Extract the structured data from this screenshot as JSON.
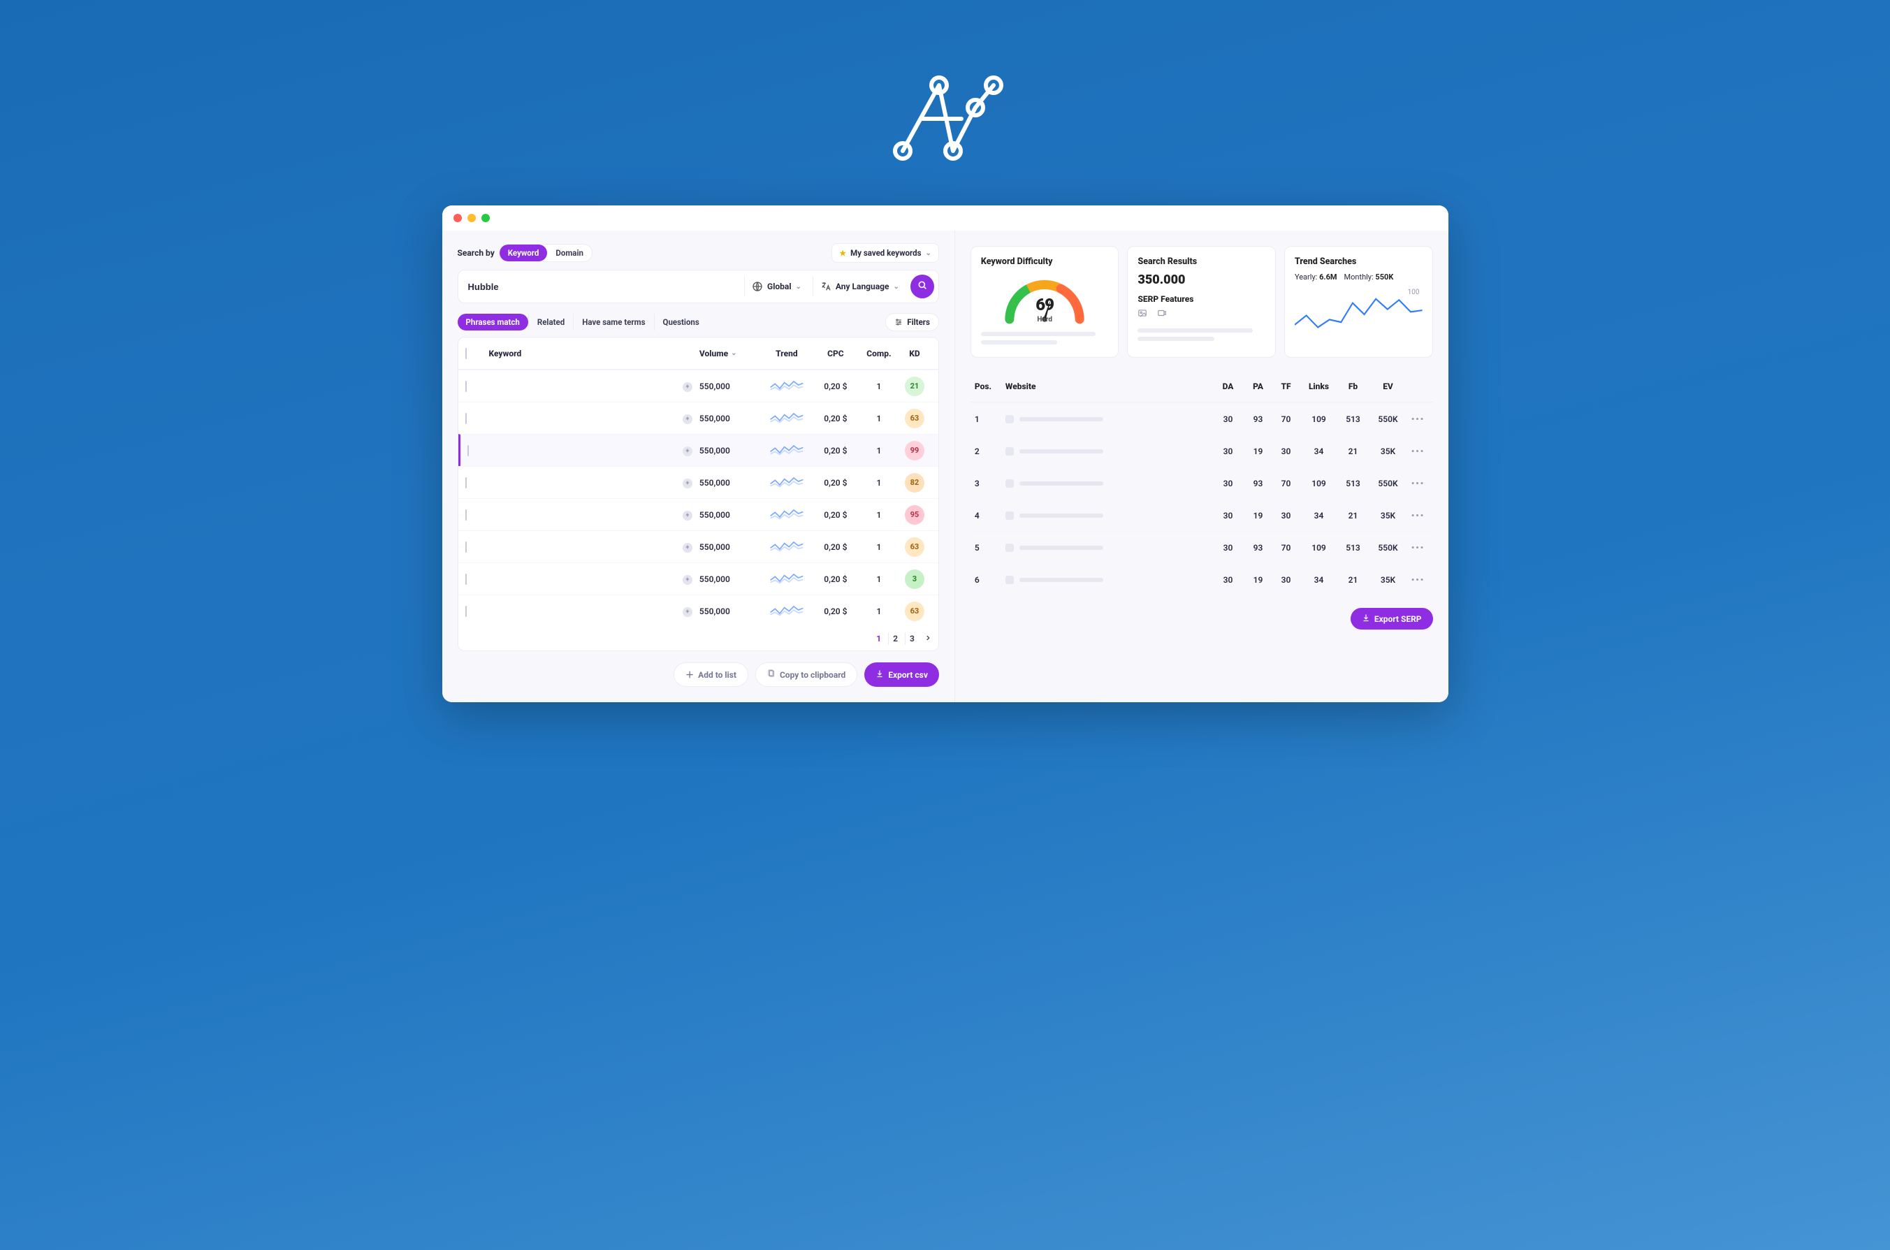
{
  "colors": {
    "accent": "#8e2de2",
    "bg_gradient_start": "#1a6bb5",
    "bg_gradient_end": "#4594d4"
  },
  "topbar": {
    "search_by_label": "Search by",
    "toggle": {
      "keyword": "Keyword",
      "domain": "Domain",
      "active": "Keyword"
    },
    "saved_keywords_label": "My saved keywords"
  },
  "searchbar": {
    "value": "Hubble",
    "region_label": "Global",
    "language_label": "Any Language"
  },
  "tabs": {
    "items": [
      "Phrases match",
      "Related",
      "Have same terms",
      "Questions"
    ],
    "active": "Phrases match",
    "filters_label": "Filters"
  },
  "kw_table": {
    "headers": {
      "keyword": "Keyword",
      "volume": "Volume",
      "trend": "Trend",
      "cpc": "CPC",
      "comp": "Comp.",
      "kd": "KD"
    },
    "rows": [
      {
        "volume": "550,000",
        "cpc": "0,20 $",
        "comp": "1",
        "kd": 21,
        "kd_class": "kd-easy"
      },
      {
        "volume": "550,000",
        "cpc": "0,20 $",
        "comp": "1",
        "kd": 63,
        "kd_class": "kd-med"
      },
      {
        "volume": "550,000",
        "cpc": "0,20 $",
        "comp": "1",
        "kd": 99,
        "kd_class": "kd-hard",
        "selected": true
      },
      {
        "volume": "550,000",
        "cpc": "0,20 $",
        "comp": "1",
        "kd": 82,
        "kd_class": "kd-med2"
      },
      {
        "volume": "550,000",
        "cpc": "0,20 $",
        "comp": "1",
        "kd": 95,
        "kd_class": "kd-hard2"
      },
      {
        "volume": "550,000",
        "cpc": "0,20 $",
        "comp": "1",
        "kd": 63,
        "kd_class": "kd-med"
      },
      {
        "volume": "550,000",
        "cpc": "0,20 $",
        "comp": "1",
        "kd": 3,
        "kd_class": "kd-easy2"
      },
      {
        "volume": "550,000",
        "cpc": "0,20 $",
        "comp": "1",
        "kd": 63,
        "kd_class": "kd-med"
      }
    ],
    "pager": {
      "pages": [
        "1",
        "2",
        "3"
      ],
      "active": "1"
    }
  },
  "actions": {
    "add_to_list": "Add to list",
    "copy_to_clipboard": "Copy to clipboard",
    "export_csv": "Export csv",
    "export_serp": "Export SERP"
  },
  "cards": {
    "difficulty": {
      "title": "Keyword Difficulty",
      "value": "69",
      "label": "Hard"
    },
    "search_results": {
      "title": "Search Results",
      "value": "350.000",
      "serp_features_title": "SERP Features"
    },
    "trend": {
      "title": "Trend Searches",
      "yearly_label": "Yearly:",
      "yearly_value": "6.6M",
      "monthly_label": "Monthly:",
      "monthly_value": "550K",
      "ymax": "100"
    }
  },
  "serp_table": {
    "headers": {
      "pos": "Pos.",
      "website": "Website",
      "da": "DA",
      "pa": "PA",
      "tf": "TF",
      "links": "Links",
      "fb": "Fb",
      "ev": "EV"
    },
    "rows": [
      {
        "pos": "1",
        "da": "30",
        "pa": "93",
        "tf": "70",
        "links": "109",
        "fb": "513",
        "ev": "550K"
      },
      {
        "pos": "2",
        "da": "30",
        "pa": "19",
        "tf": "30",
        "links": "34",
        "fb": "21",
        "ev": "35K"
      },
      {
        "pos": "3",
        "da": "30",
        "pa": "93",
        "tf": "70",
        "links": "109",
        "fb": "513",
        "ev": "550K"
      },
      {
        "pos": "4",
        "da": "30",
        "pa": "19",
        "tf": "30",
        "links": "34",
        "fb": "21",
        "ev": "35K"
      },
      {
        "pos": "5",
        "da": "30",
        "pa": "93",
        "tf": "70",
        "links": "109",
        "fb": "513",
        "ev": "550K"
      },
      {
        "pos": "6",
        "da": "30",
        "pa": "19",
        "tf": "30",
        "links": "34",
        "fb": "21",
        "ev": "35K"
      }
    ]
  },
  "chart_data": {
    "type": "line",
    "title": "Trend Searches",
    "ylabel": "",
    "xlabel": "",
    "ylim": [
      0,
      100
    ],
    "x": [
      0,
      1,
      2,
      3,
      4,
      5,
      6,
      7,
      8,
      9,
      10,
      11
    ],
    "values": [
      30,
      48,
      25,
      40,
      35,
      72,
      50,
      80,
      60,
      78,
      55,
      58
    ]
  }
}
